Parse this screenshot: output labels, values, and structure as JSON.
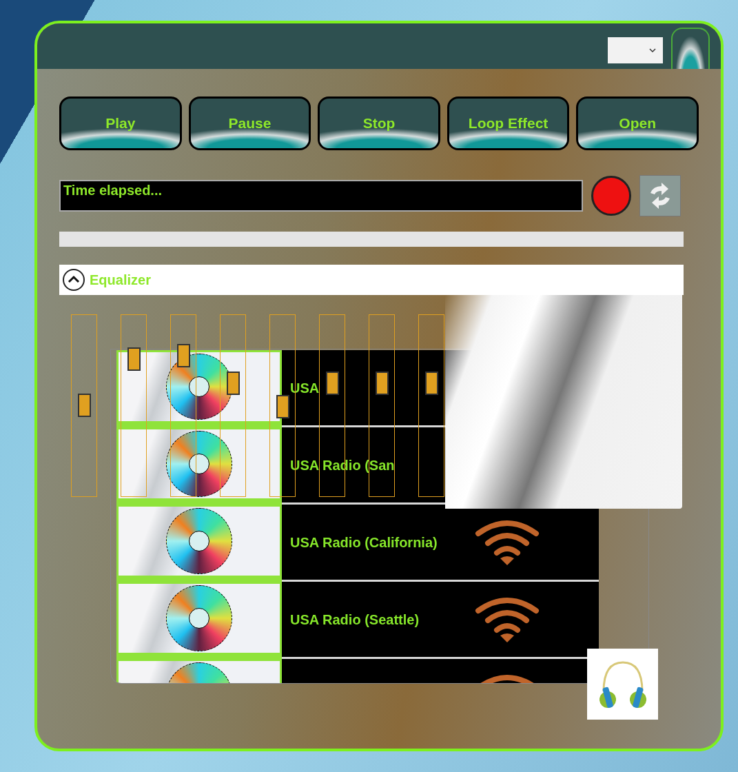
{
  "buttons": [
    "Play",
    "Pause",
    "Stop",
    "Loop Effect",
    "Open"
  ],
  "time_display": {
    "value": "Time elapsed..."
  },
  "progress": {
    "level": 0
  },
  "equalizer": {
    "label": "Equalizer",
    "expanded": true,
    "bands": [
      {
        "level": 0.5
      },
      {
        "level": 0.75
      },
      {
        "level": 0.77
      },
      {
        "level": 0.62
      },
      {
        "level": 0.49
      },
      {
        "level": 0.62
      },
      {
        "level": 0.62
      },
      {
        "level": 0.62
      }
    ]
  },
  "stations": [
    {
      "name": "USA",
      "kind": "covered"
    },
    {
      "name": "USA Radio (San",
      "kind": "covered"
    },
    {
      "name": "USA Radio (California)",
      "kind": "full"
    },
    {
      "name": "USA Radio (Seattle)",
      "kind": "full"
    }
  ]
}
